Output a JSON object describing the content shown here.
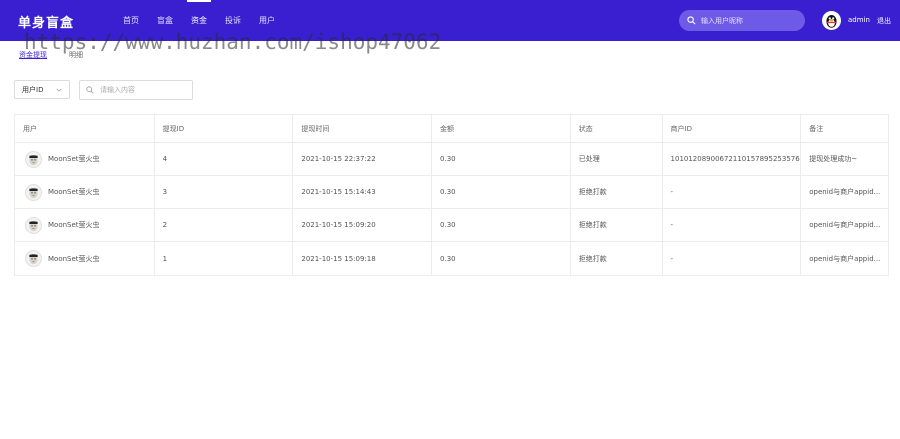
{
  "header": {
    "brand": "单身盲盒",
    "nav": [
      "首页",
      "盲盒",
      "资金",
      "投诉",
      "用户"
    ],
    "active_index": 2,
    "search_placeholder": "输入用户昵称",
    "username": "admin",
    "logout": "退出"
  },
  "watermark": "https://www.huzhan.com/ishop47062",
  "breadcrumb": {
    "link": "资金提现",
    "current": "明细"
  },
  "filter": {
    "select_value": "用户ID",
    "input_placeholder": "请输入内容"
  },
  "table": {
    "columns": [
      "用户",
      "提现ID",
      "提现时间",
      "金额",
      "状态",
      "商户ID",
      "备注"
    ],
    "rows": [
      {
        "user": "MoonSet萤火虫",
        "id": "4",
        "time": "2021-10-15 22:37:22",
        "amount": "0.30",
        "status": "已处理",
        "merchant": "1010120890067211015789525357​69...",
        "note": "提现处理成功~"
      },
      {
        "user": "MoonSet萤火虫",
        "id": "3",
        "time": "2021-10-15 15:14:43",
        "amount": "0.30",
        "status": "拒绝打款",
        "merchant": "-",
        "note": "openid与商户appid..."
      },
      {
        "user": "MoonSet萤火虫",
        "id": "2",
        "time": "2021-10-15 15:09:20",
        "amount": "0.30",
        "status": "拒绝打款",
        "merchant": "-",
        "note": "openid与商户appid..."
      },
      {
        "user": "MoonSet萤火虫",
        "id": "1",
        "time": "2021-10-15 15:09:18",
        "amount": "0.30",
        "status": "拒绝打款",
        "merchant": "-",
        "note": "openid与商户appid..."
      }
    ]
  },
  "colors": {
    "header_bg": "#3a1fd0",
    "search_bg": "#6d5ae6",
    "link": "#3a1fd0"
  },
  "icons": {
    "search": "search-icon",
    "dropdown": "chevron-down-icon",
    "avatar": "qq-penguin-icon",
    "row_avatar": "user-face-icon"
  }
}
